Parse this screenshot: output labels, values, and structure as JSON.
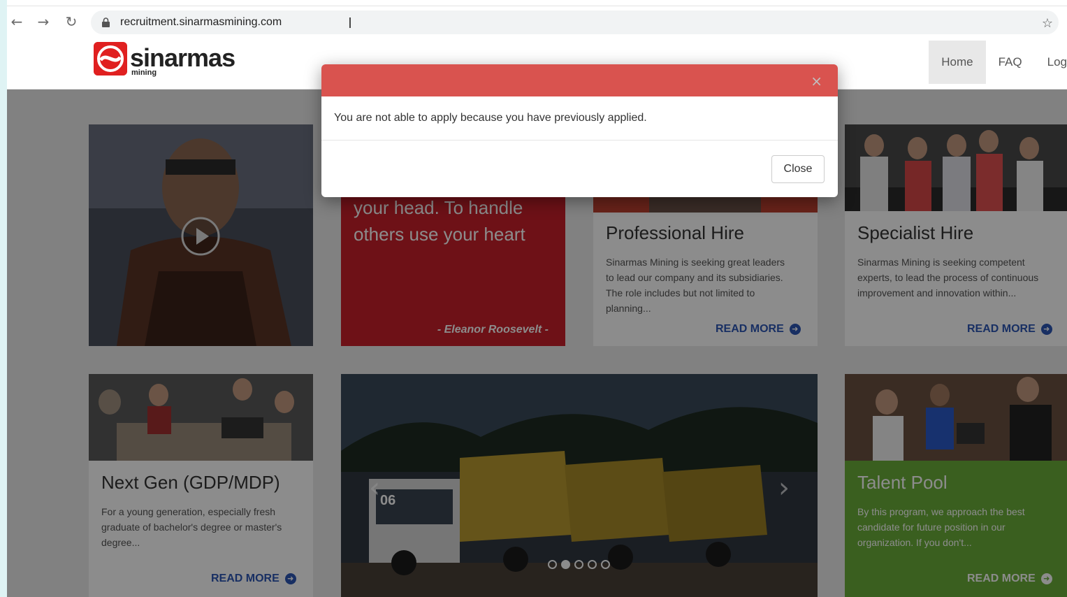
{
  "browser": {
    "url": "recruitment.sinarmasmining.com",
    "back_icon": "←",
    "forward_icon": "→",
    "reload_icon": "↻",
    "star_icon": "☆",
    "ibeam": "I"
  },
  "header": {
    "logo_text": "sinarmas",
    "logo_sub": "mining",
    "nav": [
      {
        "label": "Home",
        "active": true
      },
      {
        "label": "FAQ",
        "active": false
      },
      {
        "label": "Log",
        "active": false
      }
    ]
  },
  "tiles": {
    "quote": {
      "text_line1": "your head. To handle",
      "text_line2": "others use your heart",
      "author": "- Eleanor Roosevelt -"
    },
    "professional": {
      "title": "Professional Hire",
      "desc": "Sinarmas Mining is seeking great leaders to lead our company and its subsidiaries. The role includes but not limited to planning...",
      "read_more": "READ MORE"
    },
    "specialist": {
      "title": "Specialist Hire",
      "desc": "Sinarmas Mining is seeking competent experts, to lead the process of continuous improvement and innovation within...",
      "read_more": "READ MORE"
    },
    "nextgen": {
      "title": "Next Gen (GDP/MDP)",
      "desc": "For a young generation, especially fresh graduate of bachelor's degree or master's degree...",
      "read_more": "READ MORE"
    },
    "talent": {
      "title": "Talent Pool",
      "desc": "By this program, we approach the best candidate for future position in our organization. If you don't...",
      "read_more": "READ MORE"
    },
    "carousel": {
      "truck_number": "06",
      "dots": [
        false,
        true,
        false,
        false,
        false
      ]
    }
  },
  "modal": {
    "message": "You are not able to apply because you have previously applied.",
    "close_label": "Close",
    "x_label": "×"
  },
  "colors": {
    "modal_header": "#d9534f",
    "quote_bg": "#c8202a",
    "talent_bg": "#6aae3a",
    "link": "#2c56b5"
  }
}
